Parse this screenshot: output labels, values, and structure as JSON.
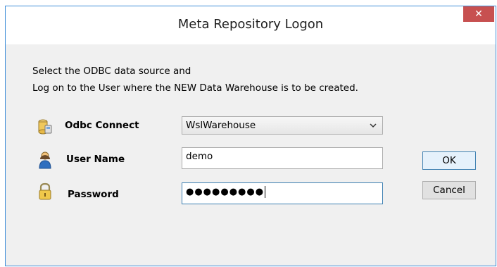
{
  "window": {
    "title": "Meta Repository Logon",
    "close_glyph": "✕"
  },
  "instructions": {
    "line1": "Select the ODBC data source and",
    "line2": "Log on to the User where the NEW Data Warehouse is to be created."
  },
  "form": {
    "odbc": {
      "label": "Odbc Connect",
      "value": "WslWarehouse",
      "icon": "database-icon"
    },
    "user": {
      "label": "User Name",
      "value": "demo",
      "icon": "user-icon"
    },
    "password": {
      "label": "Password",
      "masked_value": "●●●●●●●●●",
      "icon": "lock-icon"
    }
  },
  "buttons": {
    "ok": "OK",
    "cancel": "Cancel"
  },
  "colors": {
    "window_border": "#3e8dd8",
    "close_button": "#c75050",
    "focus_border": "#3c7fb1"
  }
}
